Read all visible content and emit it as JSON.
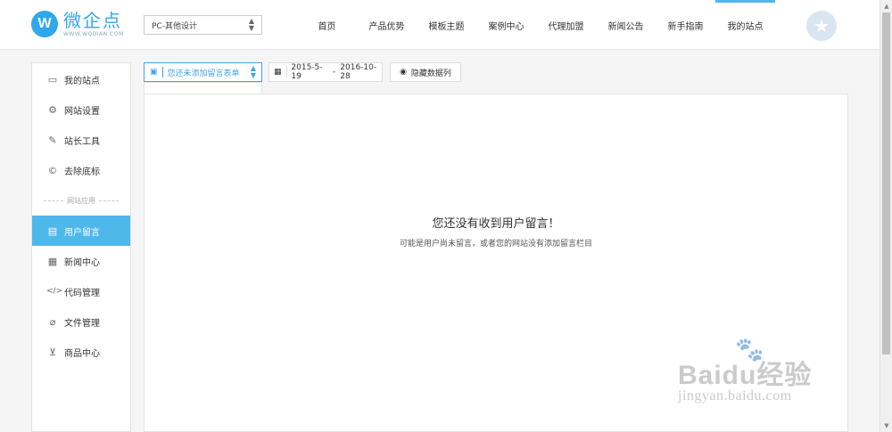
{
  "header": {
    "logo": {
      "name_cn": "微企点",
      "name_en": "WWW.WQDIAN.COM",
      "mark": "W"
    },
    "site_select": {
      "value": "PC-其他设计"
    },
    "nav": [
      {
        "label": "首页"
      },
      {
        "label": "产品优势"
      },
      {
        "label": "模板主题"
      },
      {
        "label": "案例中心"
      },
      {
        "label": "代理加盟"
      },
      {
        "label": "新闻公告"
      },
      {
        "label": "新手指南"
      },
      {
        "label": "我的站点",
        "active": true
      }
    ],
    "avatar_icon": "star-icon"
  },
  "sidebar": {
    "items": [
      {
        "label": "我的站点",
        "icon": "monitor-icon"
      },
      {
        "label": "网站设置",
        "icon": "gear-icon"
      },
      {
        "label": "站长工具",
        "icon": "wrench-icon"
      },
      {
        "label": "去除底标",
        "icon": "copyright-icon"
      }
    ],
    "section_label": "网站应用",
    "app_items": [
      {
        "label": "用户留言",
        "icon": "message-icon",
        "active": true
      },
      {
        "label": "新闻中心",
        "icon": "news-icon"
      },
      {
        "label": "代码管理",
        "icon": "code-icon"
      },
      {
        "label": "文件管理",
        "icon": "paperclip-icon"
      },
      {
        "label": "商品中心",
        "icon": "cart-icon"
      }
    ]
  },
  "toolbar": {
    "form_select": "您还未添加留言表单",
    "date_start": "2015-5-19",
    "date_sep": "-",
    "date_end": "2016-10-28",
    "hide_data": "隐藏数据列"
  },
  "content": {
    "empty_title": "您还没有收到用户留言！",
    "empty_subtitle": "可能是用户尚未留言，或者您的网站没有添加留言栏目"
  },
  "watermark": {
    "main": "Baidu经验",
    "sub": "jingyan.baidu.com"
  },
  "colors": {
    "accent": "#4fb8ea",
    "brand": "#2fa8ea",
    "select_border": "#3ea6e0"
  }
}
